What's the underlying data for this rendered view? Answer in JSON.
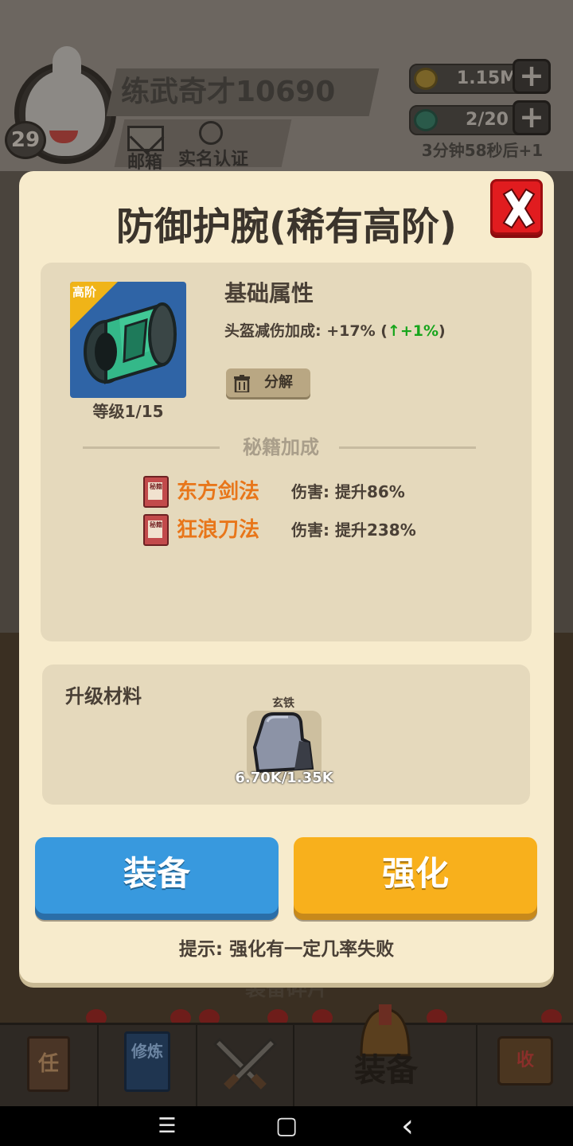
{
  "player": {
    "name": "练武奇才10690",
    "level": "29",
    "mailbox_label": "邮箱",
    "realname_label": "实名认证"
  },
  "resources": {
    "gold": "1.15M",
    "energy": "2/20",
    "energy_timer": "3分钟58秒后+1",
    "plus_symbol": "+"
  },
  "dialog": {
    "title": "防御护腕(稀有高阶)",
    "tier_tag": "高阶",
    "item_level": "等级1/15",
    "base_attr_heading": "基础属性",
    "stat_text": "头盔减伤加成: +17% (",
    "stat_arrow": "↑",
    "stat_increase": "+1%",
    "stat_close": ")",
    "decompose_label": "分解",
    "secret_heading": "秘籍加成",
    "secrets": [
      {
        "book_label": "秘籍",
        "name": "东方剑法",
        "effect": "伤害: 提升86%"
      },
      {
        "book_label": "秘籍",
        "name": "狂浪刀法",
        "effect": "伤害: 提升238%"
      }
    ],
    "materials_heading": "升级材料",
    "material": {
      "name": "玄铁",
      "count": "6.70K/1.35K"
    },
    "equip_button": "装备",
    "upgrade_button": "强化",
    "hint": "提示: 强化有一定几率失败"
  },
  "background": {
    "faded_title": "装备碎片"
  },
  "tabbar": {
    "tabs": [
      {
        "icon": "quest-scroll-icon",
        "glyph": "任"
      },
      {
        "icon": "training-book-icon",
        "glyph": "修炼"
      },
      {
        "icon": "crossed-swords-icon",
        "glyph": ""
      },
      {
        "icon": "equipment-icon",
        "label": "装备"
      },
      {
        "icon": "collection-icon",
        "glyph": "收"
      }
    ]
  },
  "system_nav": {
    "menu": "☰",
    "home": "▢",
    "back": "‹"
  },
  "colors": {
    "dialog_bg": "#f7ebcc",
    "equip_button": "#3899de",
    "upgrade_button": "#f8b01c",
    "close_button": "#e11c1f",
    "skill_name": "#e8761a",
    "stat_increase": "#17a51c"
  }
}
